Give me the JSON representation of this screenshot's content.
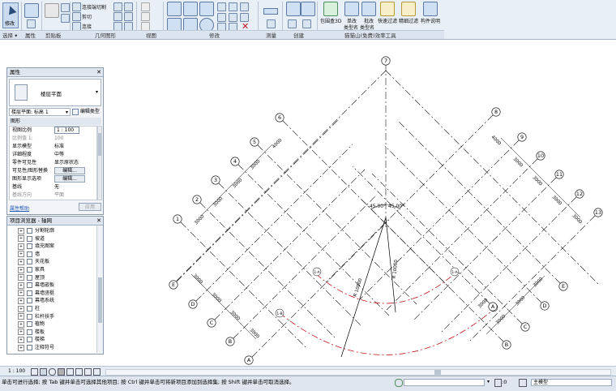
{
  "ribbon": {
    "select_button": "修改",
    "panels": [
      "选择 ▾",
      "属性",
      "剪贴板",
      "几何图形",
      "视图",
      "修改",
      "测量",
      "创建",
      "猫猫山(免费)效率工具"
    ],
    "geometry_items": [
      "连接端切割",
      "剪切",
      "连接"
    ],
    "tools": [
      {
        "label": "包围盒3D",
        "sub": ""
      },
      {
        "label": "单改",
        "sub": "类型名"
      },
      {
        "label": "批改",
        "sub": "类型名"
      },
      {
        "label": "快速过滤",
        "sub": ""
      },
      {
        "label": "精细过滤",
        "sub": ""
      },
      {
        "label": "构件说明",
        "sub": ""
      }
    ]
  },
  "properties": {
    "title": "属性",
    "type_name": "楼层平面",
    "view_selector": "楼层平面: 标高 1",
    "edit_type": "编辑类型",
    "section": "图形",
    "rows": [
      {
        "k": "视图比例",
        "v": "1 : 100"
      },
      {
        "k": "比例值 1:",
        "v": "100"
      },
      {
        "k": "显示模型",
        "v": "标准"
      },
      {
        "k": "详细程度",
        "v": "中等"
      },
      {
        "k": "零件可见性",
        "v": "显示原状态"
      },
      {
        "k": "可见性/图形替换",
        "v": "编辑..."
      },
      {
        "k": "图形显示选项",
        "v": "编辑..."
      },
      {
        "k": "基线",
        "v": "无"
      },
      {
        "k": "基线方向",
        "v": "平面"
      }
    ],
    "help_link": "属性帮助",
    "apply": "应用"
  },
  "browser": {
    "title": "项目浏览器 - 轴网",
    "items": [
      "分割轮廓",
      "坡道",
      "填充图案",
      "墙",
      "天花板",
      "家具",
      "屋顶",
      "幕墙嵌板",
      "幕墙竖梃",
      "幕墙系统",
      "柱",
      "栏杆扶手",
      "植物",
      "楼板",
      "楼梯",
      "注释符号"
    ]
  },
  "drawing": {
    "top_grid": "7",
    "left_grids": [
      "6",
      "5",
      "4",
      "3",
      "2",
      "1"
    ],
    "right_grids": [
      "8",
      "9",
      "10",
      "11",
      "12",
      "13"
    ],
    "lower_left_grids": [
      "E",
      "D",
      "C",
      "B",
      "A"
    ],
    "lower_right_grids": [
      "E",
      "D",
      "C",
      "B",
      "A"
    ],
    "dims_left": [
      "4000",
      "3000",
      "3000",
      "3000",
      "3000"
    ],
    "dims_right": [
      "4000",
      "3000",
      "3000",
      "3000",
      "3000"
    ],
    "dims_lower_left": [
      "3000",
      "3000",
      "3000",
      "3000"
    ],
    "dims_lower_right": [
      "3000",
      "3000",
      "3000",
      "3000"
    ],
    "angle_left": "45.00°",
    "angle_right": "45.00°",
    "radius_left": "R 10000",
    "radius_right": "R 10000",
    "arc_markers": [
      "1-A",
      "1-A",
      "1-B",
      "1-B"
    ]
  },
  "viewbar": {
    "scale": "1 : 100"
  },
  "status": {
    "message": "单击可进行选择; 按 Tab 键并单击可选择其他项目; 按 Ctrl 键并单击可将新项目添加到选择集; 按 Shift 键并单击可取消选择。",
    "count": ":0",
    "model": "主模型"
  },
  "colors": {
    "ribbon_bg": "#e9eff6",
    "redline": "#c0151b",
    "accent": "#3c6eb4"
  }
}
